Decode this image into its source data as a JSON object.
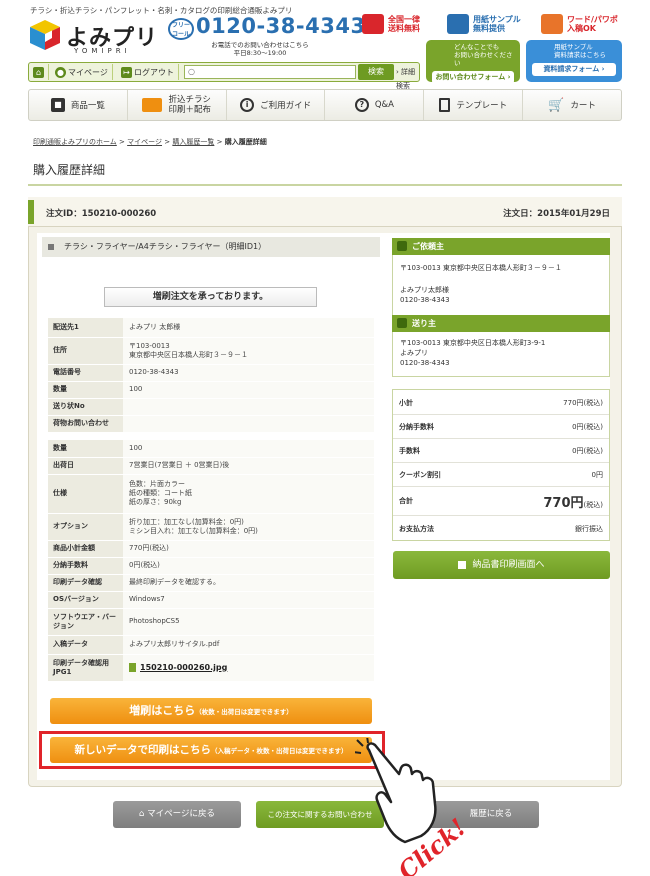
{
  "header": {
    "tagline": "チラシ・折込チラシ・パンフレット・名刺・カタログの印刷総合通販よみプリ",
    "logo_text": "よみプリ",
    "logo_sub": "YOMIPRI",
    "phone_badge": "フリーコール",
    "phone": "0120-38-4343",
    "phone_note_1": "お電話でのお問い合わせはこちら",
    "phone_note_2": "平日8:30〜19:00",
    "features": [
      {
        "line1": "全国一律",
        "line2": "送料無料",
        "color": "#d9262c"
      },
      {
        "line1": "用紙サンプル",
        "line2": "無料提供",
        "color": "#2a6fb0"
      },
      {
        "line1": "ワード/パワポ",
        "line2": "入稿OK",
        "color": "#d9262c"
      }
    ],
    "contact_box": {
      "line1": "どんなことでも",
      "line2": "お問い合わせください",
      "button": "お問い合わせフォーム ›"
    },
    "sample_box": {
      "line1": "用紙サンプル",
      "line2": "資料請求はこちら",
      "button": "資料請求フォーム ›"
    }
  },
  "toolbar": {
    "mypage": "マイページ",
    "logout": "ログアウト",
    "search_button": "検索",
    "advanced": "› 詳細検索"
  },
  "nav": [
    {
      "label": "商品一覧",
      "icon": "cube-icon"
    },
    {
      "label": "折込チラシ\n印刷＋配布",
      "icon": "factory-icon"
    },
    {
      "label": "ご利用ガイド",
      "icon": "info-icon"
    },
    {
      "label": "Q&A",
      "icon": "question-icon"
    },
    {
      "label": "テンプレート",
      "icon": "template-icon"
    },
    {
      "label": "カート",
      "icon": "cart-icon"
    }
  ],
  "breadcrumb": {
    "home": "印刷通販よみプリのホーム",
    "mypage": "マイページ",
    "history": "購入履歴一覧",
    "current": "購入履歴詳細",
    "sep": ">"
  },
  "page_title": "購入履歴詳細",
  "order": {
    "number": "注文ID：150210-000260",
    "date": "注文日：2015年01月29日"
  },
  "item": {
    "heading": "チラシ・フライヤー/A4チラシ・フライヤー（明細ID1）",
    "notice": "増刷注文を承っております。",
    "shipping": [
      {
        "k": "配送先1",
        "v": "よみプリ 太郎様"
      },
      {
        "k": "住所",
        "v": "〒103-0013\n東京都中央区日本橋人形町３－９－１"
      },
      {
        "k": "電話番号",
        "v": "0120-38-4343"
      },
      {
        "k": "数量",
        "v": "100"
      },
      {
        "k": "送り状No",
        "v": ""
      },
      {
        "k": "荷物お問い合わせ",
        "v": ""
      }
    ],
    "details": [
      {
        "k": "数量",
        "v": "100"
      },
      {
        "k": "出荷日",
        "v": "7営業日(7営業日 ＋ 0営業日)後"
      },
      {
        "k": "仕様",
        "v": "色数：片面カラー\n紙の種類：コート紙\n紙の厚さ：90kg"
      },
      {
        "k": "オプション",
        "v": "折り加工：加工なし(加算料金：0円)\nミシン目入れ：加工なし(加算料金：0円)"
      },
      {
        "k": "商品小計金額",
        "v": "770円(税込)"
      },
      {
        "k": "分納手数料",
        "v": "0円(税込)"
      },
      {
        "k": "印刷データ確認",
        "v": "最終印刷データを確認する。"
      },
      {
        "k": "OSバージョン",
        "v": "Windows7"
      },
      {
        "k": "ソフトウエア・バージョン",
        "v": "PhotoshopCS5"
      },
      {
        "k": "入稿データ",
        "v": "よみプリ太郎リサイタル.pdf"
      }
    ],
    "jpg_label": "印刷データ確認用JPG1",
    "jpg_file": "150210-000260.jpg",
    "reprint_button": "増刷はこちら",
    "reprint_note": "（枚数・出荷日は変更できます）",
    "newdata_button": "新しいデータで印刷はこちら",
    "newdata_note": "（入稿データ・枚数・出荷日は変更できます）"
  },
  "client": {
    "heading": "ご依頼主",
    "address": "〒103-0013 東京都中央区日本橋人形町３－９－１",
    "name": "よみプリ太郎様",
    "phone": "0120-38-4343"
  },
  "sender": {
    "heading": "送り主",
    "address": "〒103-0013 東京都中央区日本橋人形町3-9-1",
    "name": "よみプリ",
    "phone": "0120-38-4343"
  },
  "summary": [
    {
      "k": "小計",
      "v": "770円(税込)"
    },
    {
      "k": "分納手数料",
      "v": "0円(税込)"
    },
    {
      "k": "手数料",
      "v": "0円(税込)"
    },
    {
      "k": "クーポン割引",
      "v": "0円"
    }
  ],
  "total": {
    "k": "合計",
    "v": "770円",
    "tax": "(税込)"
  },
  "payment": {
    "k": "お支払方法",
    "v": "銀行振込"
  },
  "delivery_button": "納品書印刷画面へ",
  "bottom": {
    "back_mypage": "マイページに戻る",
    "inquiry": "この注文に関するお問い合わせ",
    "back_history": "履歴に戻る"
  },
  "click_label": "Click!",
  "colors": {
    "brand_green": "#7aa42b",
    "phone_blue": "#2a6fb0",
    "orange": "#ef8f10",
    "highlight_red": "#e0242a"
  }
}
